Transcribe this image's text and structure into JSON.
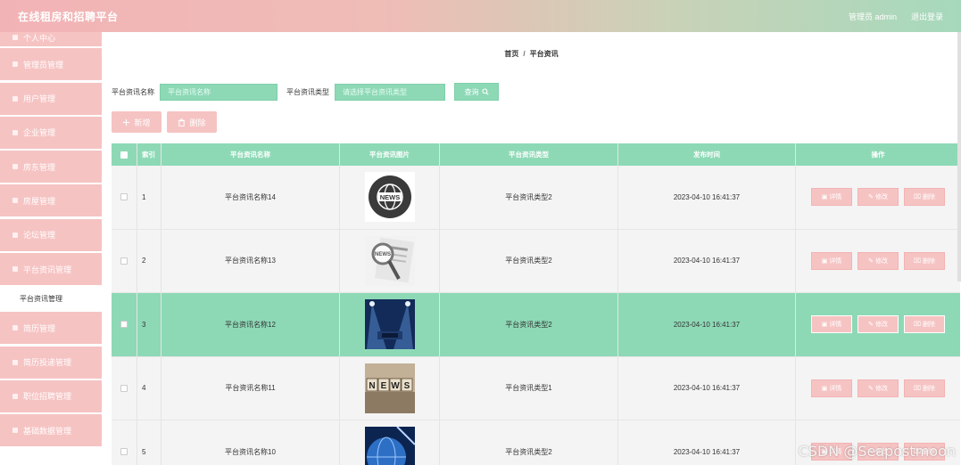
{
  "header": {
    "title": "在线租房和招聘平台",
    "admin_label": "管理员 admin",
    "logout_label": "退出登录"
  },
  "sidebar": {
    "items": [
      {
        "label": "个人中心"
      },
      {
        "label": "管理员管理"
      },
      {
        "label": "用户管理"
      },
      {
        "label": "企业管理"
      },
      {
        "label": "房东管理"
      },
      {
        "label": "房屋管理"
      },
      {
        "label": "论坛管理"
      },
      {
        "label": "平台资讯管理"
      },
      {
        "label": "平台资讯管理"
      },
      {
        "label": "简历管理"
      },
      {
        "label": "简历投递管理"
      },
      {
        "label": "职位招聘管理"
      },
      {
        "label": "基础数据管理"
      }
    ]
  },
  "breadcrumb": {
    "home": "首页",
    "separator": "/",
    "current": "平台资讯"
  },
  "search": {
    "name_label": "平台资讯名称",
    "name_placeholder": "平台资讯名称",
    "type_label": "平台资讯类型",
    "type_placeholder": "请选择平台资讯类型",
    "button_label": "查询"
  },
  "actions": {
    "add_label": "新增",
    "delete_label": "删除"
  },
  "table": {
    "columns": [
      "索引",
      "平台资讯名称",
      "平台资讯图片",
      "平台资讯类型",
      "发布时间",
      "操作"
    ],
    "rows": [
      {
        "index": "1",
        "name": "平台资讯名称14",
        "image_icon": "news-globe-icon",
        "type": "平台资讯类型2",
        "time": "2023-04-10 16:41:37",
        "highlighted": false
      },
      {
        "index": "2",
        "name": "平台资讯名称13",
        "image_icon": "newspaper-magnifier-image",
        "type": "平台资讯类型2",
        "time": "2023-04-10 16:41:37",
        "highlighted": false
      },
      {
        "index": "3",
        "name": "平台资讯名称12",
        "image_icon": "stage-spotlight-image",
        "type": "平台资讯类型2",
        "time": "2023-04-10 16:41:37",
        "highlighted": true
      },
      {
        "index": "4",
        "name": "平台资讯名称11",
        "image_icon": "news-blocks-image",
        "type": "平台资讯类型1",
        "time": "2023-04-10 16:41:37",
        "highlighted": false
      },
      {
        "index": "5",
        "name": "平台资讯名称10",
        "image_icon": "globe-blue-image",
        "type": "平台资讯类型2",
        "time": "2023-04-10 16:41:37",
        "highlighted": false
      }
    ],
    "op_labels": {
      "detail": "详情",
      "edit": "修改",
      "delete": "删除"
    }
  },
  "watermark": "CSDN @Seapostmoon",
  "colors": {
    "accent_green": "#8dd9b6",
    "accent_pink": "#f6c3c3"
  }
}
